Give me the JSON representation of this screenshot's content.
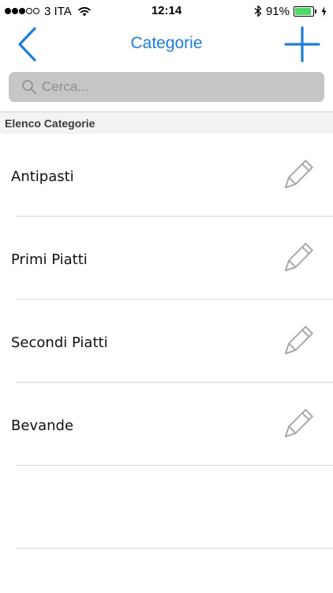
{
  "status_bar": {
    "carrier": "3 ITA",
    "signal_icon": "signal-dots-icon",
    "wifi_icon": "wifi-icon",
    "time": "12:14",
    "bluetooth_icon": "bluetooth-icon",
    "battery_percent": "91%",
    "battery_level": 0.91,
    "battery_icon": "battery-icon",
    "charging_icon": "charging-bolt-icon",
    "battery_color": "#4cd964"
  },
  "nav": {
    "title": "Categorie",
    "back_icon": "chevron-left-icon",
    "add_icon": "plus-icon",
    "accent_color": "#1f7ed6"
  },
  "search": {
    "placeholder": "Cerca...",
    "value": "",
    "icon": "search-icon"
  },
  "section": {
    "header": "Elenco Categorie"
  },
  "categories": [
    {
      "label": "Antipasti",
      "edit_icon": "pencil-icon"
    },
    {
      "label": "Primi Piatti",
      "edit_icon": "pencil-icon"
    },
    {
      "label": "Secondi Piatti",
      "edit_icon": "pencil-icon"
    },
    {
      "label": "Bevande",
      "edit_icon": "pencil-icon"
    }
  ]
}
